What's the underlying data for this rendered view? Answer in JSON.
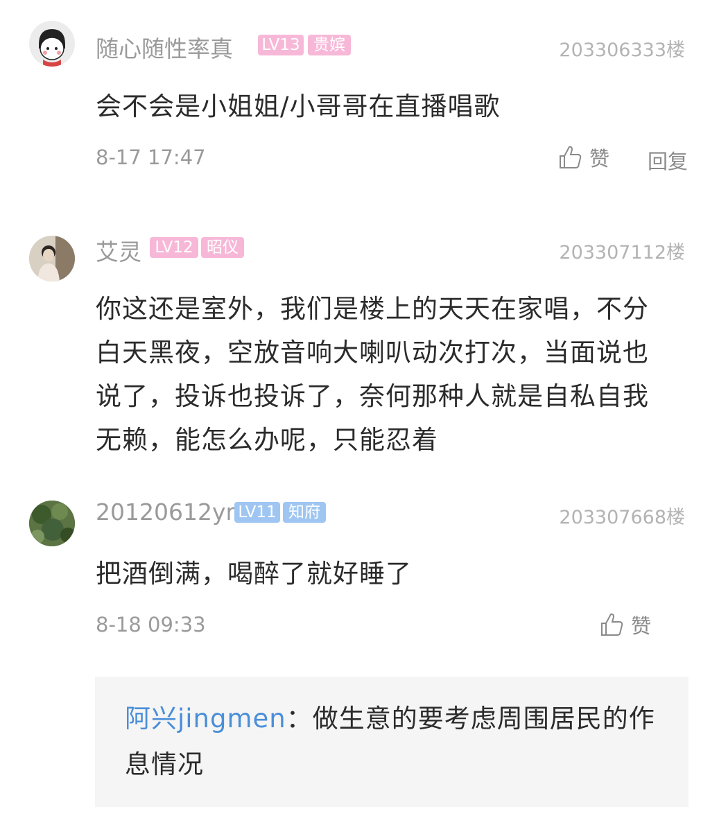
{
  "comments": [
    {
      "username": "随心随性率真",
      "level": "LV13",
      "title": "贵嫔",
      "floor": "203306333楼",
      "content": "会不会是小姐姐/小哥哥在直播唱歌",
      "time": "8-17 17:47",
      "like_label": "赞",
      "reply_label": "回复"
    },
    {
      "username": "艾灵",
      "level": "LV12",
      "title": "昭仪",
      "floor": "203307112楼",
      "content": "你这还是室外，我们是楼上的天天在家唱，不分白天黑夜，空放音响大喇叭动次打次，当面说也说了，投诉也投诉了，奈何那种人就是自私自我无赖，能怎么办呢，只能忍着"
    },
    {
      "username": "20120612ym",
      "level": "LV11",
      "title": "知府",
      "floor": "203307668楼",
      "content": "把酒倒满，喝醉了就好睡了",
      "time": "8-18 09:33",
      "like_label": "赞"
    }
  ],
  "reply": {
    "name": "阿兴jingmen",
    "separator": "：",
    "text": "做生意的要考虑周围居民的作息情况"
  },
  "colors": {
    "badge_pink": "#f7b8d8",
    "badge_blue": "#9fc6f2",
    "reply_name": "#4a8ed8"
  }
}
